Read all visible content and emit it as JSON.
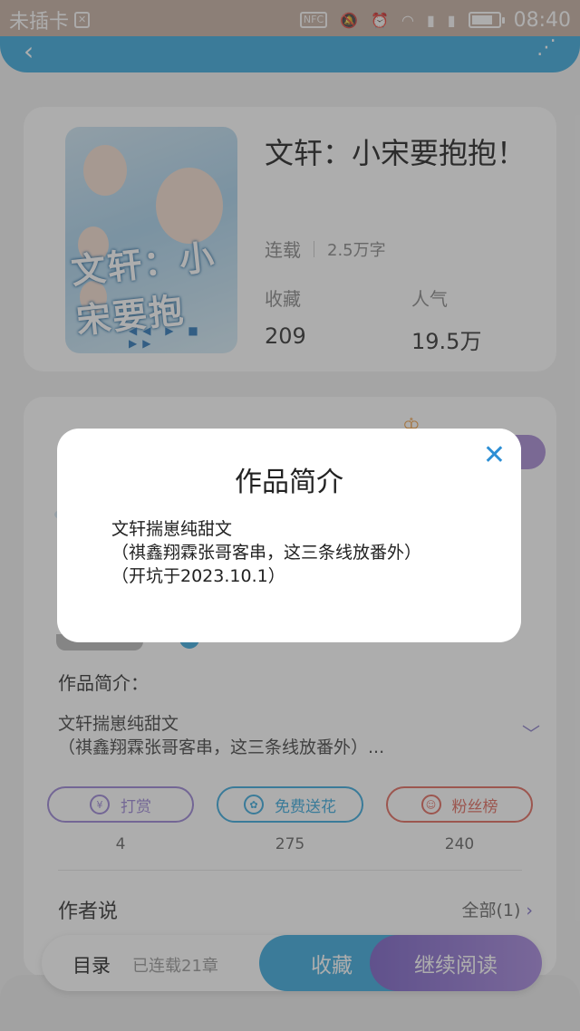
{
  "status_bar": {
    "carrier": "未插卡",
    "time": "08:40",
    "nfc_label": "NFC",
    "battery_level": 0.8
  },
  "book": {
    "title": "文轩：小宋要抱抱！",
    "status": "连载",
    "word_count": "2.5万字",
    "collect_label": "收藏",
    "collect_value": "209",
    "popularity_label": "人气",
    "popularity_value": "19.5万",
    "cover_art_text": "文轩：小宋要抱"
  },
  "detail": {
    "intro_label": "作品简介：",
    "intro_line1": "文轩揣崽纯甜文",
    "intro_line2": "（祺鑫翔霖张哥客串，这三条线放番外）..."
  },
  "actions": [
    {
      "label": "打赏",
      "count": "4",
      "color": "#9b86d6",
      "icon": "yen-coin-icon"
    },
    {
      "label": "免费送花",
      "count": "275",
      "color": "#3aa9dd",
      "icon": "flower-icon"
    },
    {
      "label": "粉丝榜",
      "count": "240",
      "color": "#e26a5e",
      "icon": "fan-ranking-icon"
    }
  ],
  "author": {
    "label": "作者说",
    "all_label": "全部(1)"
  },
  "bottom_bar": {
    "catalog_label": "目录",
    "chapters_label": "已连载21章",
    "collect_label": "收藏",
    "read_label": "继续阅读"
  },
  "modal": {
    "title": "作品简介",
    "line1": "文轩揣崽纯甜文",
    "line2": "（祺鑫翔霖张哥客串，这三条线放番外）",
    "line3": "（开坑于2023.10.1）",
    "close_symbol": "✕"
  }
}
